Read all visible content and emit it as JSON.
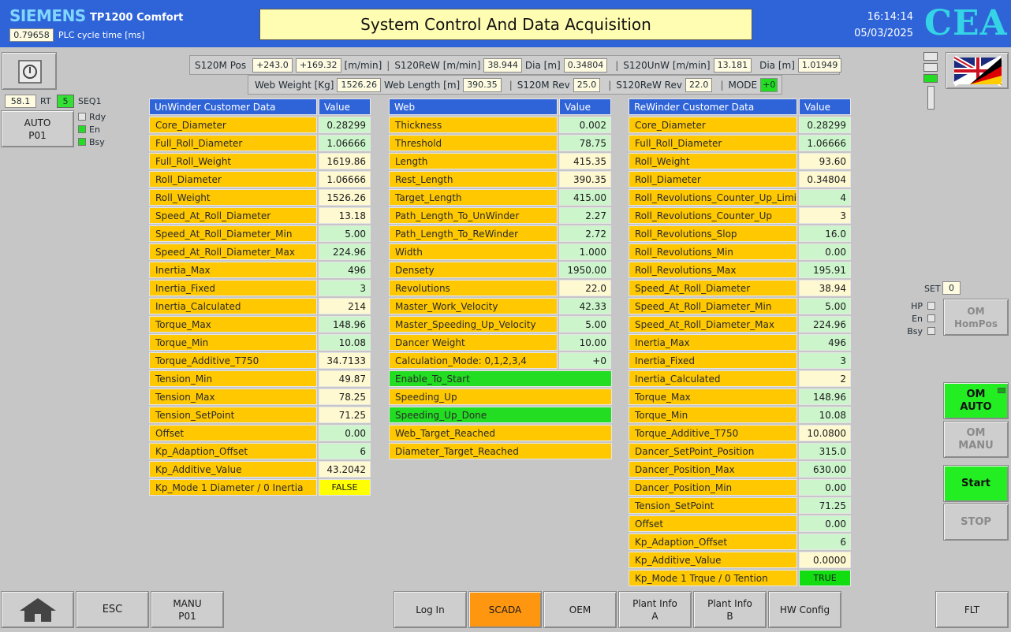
{
  "header": {
    "brand": "SIEMENS",
    "model": "TP1200 Comfort",
    "cycle_value": "0.79658",
    "cycle_label": "PLC cycle time [ms]",
    "title": "System Control And Data Acquisition",
    "time": "16:14:14",
    "date": "05/03/2025",
    "logo": "CEA"
  },
  "left": {
    "rt_value": "58.1",
    "rt_label": "RT",
    "seq_value": "5",
    "seq_label": "SEQ1",
    "auto_line1": "AUTO",
    "auto_line2": "P01",
    "indicators": [
      {
        "label": "Rdy",
        "on": false
      },
      {
        "label": "En",
        "on": true
      },
      {
        "label": "Bsy",
        "on": true
      }
    ]
  },
  "status": {
    "s120m_pos_label": "S120M Pos",
    "s120m_pos_value": "+243.0",
    "s120m_speed_value": "+169.32",
    "s120m_speed_unit": "[m/min]",
    "s120rew_label": "S120ReW [m/min]",
    "s120rew_value": "38.944",
    "dia_label": "Dia [m]",
    "rew_dia_value": "0.34804",
    "s120unw_label": "S120UnW [m/min]",
    "s120unw_value": "13.181",
    "unw_dia_value": "1.01949",
    "web_weight_label": "Web Weight [Kg]",
    "web_weight_value": "1526.26",
    "web_length_label": "Web Length [m]",
    "web_length_value": "390.35",
    "s120m_rev_label": "S120M Rev",
    "s120m_rev_value": "25.0",
    "s120rew_rev_label": "S120ReW Rev",
    "s120rew_rev_value": "22.0",
    "mode_label": "MODE",
    "mode_value": "+0"
  },
  "unwinder": {
    "title": "UnWinder Customer Data",
    "value_header": "Value",
    "rows": [
      {
        "name": "Core_Diameter",
        "value": "0.28299",
        "style": "g"
      },
      {
        "name": "Full_Roll_Diameter",
        "value": "1.06666",
        "style": "g"
      },
      {
        "name": "Full_Roll_Weight",
        "value": "1619.86",
        "style": "y"
      },
      {
        "name": "Roll_Diameter",
        "value": "1.06666",
        "style": "y"
      },
      {
        "name": "Roll_Weight",
        "value": "1526.26",
        "style": "y"
      },
      {
        "name": "Speed_At_Roll_Diameter",
        "value": "13.18",
        "style": "y"
      },
      {
        "name": "Speed_At_Roll_Diameter_Min",
        "value": "5.00",
        "style": "g"
      },
      {
        "name": "Speed_At_Roll_Diameter_Max",
        "value": "224.96",
        "style": "g"
      },
      {
        "name": "Inertia_Max",
        "value": "496",
        "style": "g"
      },
      {
        "name": "Inertia_Fixed",
        "value": "3",
        "style": "g"
      },
      {
        "name": "Inertia_Calculated",
        "value": "214",
        "style": "y"
      },
      {
        "name": "Torque_Max",
        "value": "148.96",
        "style": "g"
      },
      {
        "name": "Torque_Min",
        "value": "10.08",
        "style": "g"
      },
      {
        "name": "Torque_Additive_T750",
        "value": "34.7133",
        "style": "y"
      },
      {
        "name": "Tension_Min",
        "value": "49.87",
        "style": "y"
      },
      {
        "name": "Tension_Max",
        "value": "78.25",
        "style": "y"
      },
      {
        "name": "Tension_SetPoint",
        "value": "71.25",
        "style": "y"
      },
      {
        "name": "Offset",
        "value": "0.00",
        "style": "g"
      },
      {
        "name": "Kp_Adaption_Offset",
        "value": "6",
        "style": "g"
      },
      {
        "name": "Kp_Additive_Value",
        "value": "43.2042",
        "style": "y"
      },
      {
        "name": "Kp_Mode 1 Diameter / 0 Inertia",
        "value": "FALSE",
        "style": "false"
      }
    ]
  },
  "web": {
    "title": "Web",
    "value_header": "Value",
    "rows": [
      {
        "name": "Thickness",
        "value": "0.002",
        "style": "g"
      },
      {
        "name": "Threshold",
        "value": "78.75",
        "style": "g"
      },
      {
        "name": "Length",
        "value": "415.35",
        "style": "y"
      },
      {
        "name": "Rest_Length",
        "value": "390.35",
        "style": "y"
      },
      {
        "name": "Target_Length",
        "value": "415.00",
        "style": "g"
      },
      {
        "name": "Path_Length_To_UnWinder",
        "value": "2.27",
        "style": "g"
      },
      {
        "name": "Path_Length_To_ReWinder",
        "value": "2.72",
        "style": "g"
      },
      {
        "name": "Width",
        "value": "1.000",
        "style": "g"
      },
      {
        "name": "Densety",
        "value": "1950.00",
        "style": "g"
      },
      {
        "name": "Revolutions",
        "value": "22.0",
        "style": "y"
      },
      {
        "name": "Master_Work_Velocity",
        "value": "42.33",
        "style": "g"
      },
      {
        "name": "Master_Speeding_Up_Velocity",
        "value": "5.00",
        "style": "g"
      },
      {
        "name": "Dancer Weight",
        "value": "10.00",
        "style": "g"
      },
      {
        "name": "Calculation_Mode: 0,1,2,3,4",
        "value": "+0",
        "style": "g"
      }
    ],
    "flags": [
      {
        "label": "Enable_To_Start",
        "on": true
      },
      {
        "label": "Speeding_Up",
        "on": false
      },
      {
        "label": "Speeding_Up_Done",
        "on": true
      },
      {
        "label": "Web_Target_Reached",
        "on": false
      },
      {
        "label": "Diameter_Target_Reached",
        "on": false
      }
    ]
  },
  "rewinder": {
    "title": "ReWinder Customer Data",
    "value_header": "Value",
    "rows": [
      {
        "name": "Core_Diameter",
        "value": "0.28299",
        "style": "g"
      },
      {
        "name": "Full_Roll_Diameter",
        "value": "1.06666",
        "style": "g"
      },
      {
        "name": "Roll_Weight",
        "value": "93.60",
        "style": "y"
      },
      {
        "name": "Roll_Diameter",
        "value": "0.34804",
        "style": "y"
      },
      {
        "name": "Roll_Revolutions_Counter_Up_Limit",
        "value": "4",
        "style": "g"
      },
      {
        "name": "Roll_Revolutions_Counter_Up",
        "value": "3",
        "style": "y"
      },
      {
        "name": "Roll_Revolutions_Slop",
        "value": "16.0",
        "style": "g"
      },
      {
        "name": "Roll_Revolutions_Min",
        "value": "0.00",
        "style": "g"
      },
      {
        "name": "Roll_Revolutions_Max",
        "value": "195.91",
        "style": "g"
      },
      {
        "name": "Speed_At_Roll_Diameter",
        "value": "38.94",
        "style": "y"
      },
      {
        "name": "Speed_At_Roll_Diameter_Min",
        "value": "5.00",
        "style": "g"
      },
      {
        "name": "Speed_At_Roll_Diameter_Max",
        "value": "224.96",
        "style": "g"
      },
      {
        "name": "Inertia_Max",
        "value": "496",
        "style": "g"
      },
      {
        "name": "Inertia_Fixed",
        "value": "3",
        "style": "g"
      },
      {
        "name": "Inertia_Calculated",
        "value": "2",
        "style": "y"
      },
      {
        "name": "Torque_Max",
        "value": "148.96",
        "style": "g"
      },
      {
        "name": "Torque_Min",
        "value": "10.08",
        "style": "g"
      },
      {
        "name": "Torque_Additive_T750",
        "value": "10.0800",
        "style": "y"
      },
      {
        "name": "Dancer_SetPoint_Position",
        "value": "315.0",
        "style": "g"
      },
      {
        "name": "Dancer_Position_Max",
        "value": "630.00",
        "style": "g"
      },
      {
        "name": "Dancer_Position_Min",
        "value": "0.00",
        "style": "g"
      },
      {
        "name": "Tension_SetPoint",
        "value": "71.25",
        "style": "g"
      },
      {
        "name": "Offset",
        "value": "0.00",
        "style": "g"
      },
      {
        "name": "Kp_Adaption_Offset",
        "value": "6",
        "style": "g"
      },
      {
        "name": "Kp_Additive_Value",
        "value": "0.0000",
        "style": "y"
      },
      {
        "name": "Kp_Mode 1 Trque / 0 Tention",
        "value": "TRUE",
        "style": "true"
      }
    ]
  },
  "right": {
    "set_label": "SET",
    "set_value": "0",
    "indicators": [
      {
        "label": "HP",
        "on": false
      },
      {
        "label": "En",
        "on": false
      },
      {
        "label": "Bsy",
        "on": false
      }
    ],
    "om_hompos_line1": "OM",
    "om_hompos_line2": "HomPos",
    "om_auto_line1": "OM",
    "om_auto_line2": "AUTO",
    "om_manu_line1": "OM",
    "om_manu_line2": "MANU",
    "start": "Start",
    "stop": "STOP"
  },
  "bottom": {
    "esc": "ESC",
    "manu_line1": "MANU",
    "manu_line2": "P01",
    "login": "Log In",
    "scada": "SCADA",
    "oem": "OEM",
    "plant_a_line1": "Plant Info",
    "plant_a_line2": "A",
    "plant_b_line1": "Plant Info",
    "plant_b_line2": "B",
    "hw_config": "HW Config",
    "flt": "FLT"
  },
  "colors": {
    "header_blue": "#2f64d8",
    "name_orange": "#ffc800",
    "value_green": "#ccf5cc",
    "value_yellow": "#fff9d2",
    "active_green": "#22ee22",
    "scada_orange": "#ff9610"
  },
  "icons": [
    "power-icon",
    "home-icon",
    "language-flag-icon"
  ]
}
